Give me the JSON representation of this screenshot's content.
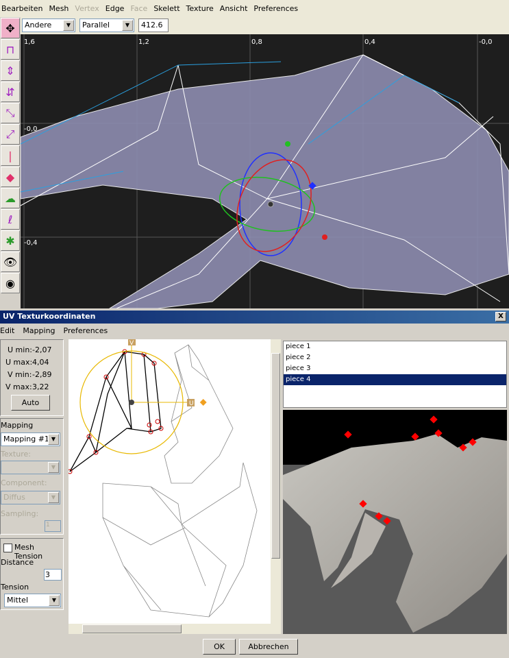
{
  "menubar": {
    "items": [
      {
        "label": "Bearbeiten",
        "enabled": true
      },
      {
        "label": "Mesh",
        "enabled": true
      },
      {
        "label": "Vertex",
        "enabled": false
      },
      {
        "label": "Edge",
        "enabled": true
      },
      {
        "label": "Face",
        "enabled": false
      },
      {
        "label": "Skelett",
        "enabled": true
      },
      {
        "label": "Texture",
        "enabled": true
      },
      {
        "label": "Ansicht",
        "enabled": true
      },
      {
        "label": "Preferences",
        "enabled": true
      }
    ]
  },
  "toolbar": {
    "view_select": "Andere",
    "projection_select": "Parallel",
    "zoom_value": "412.6"
  },
  "viewport": {
    "x_ticks": [
      "1,6",
      "1,2",
      "0,8",
      "0,4",
      "-0,0"
    ],
    "y_ticks": [
      "-0,0",
      "-0,4"
    ]
  },
  "dialog": {
    "title": "UV Texturkoordinaten",
    "close": "X",
    "menu": [
      "Edit",
      "Mapping",
      "Preferences"
    ],
    "ranges": {
      "umin_label": "U min:",
      "umin": "-2,07",
      "umax_label": "U max:",
      "umax": "4,04",
      "vmin_label": "V min:",
      "vmin": "-2,89",
      "vmax_label": "V max:",
      "vmax": "3,22",
      "auto": "Auto"
    },
    "mapping": {
      "title": "Mapping",
      "value": "Mapping #1",
      "texture_label": "Texture:",
      "texture_value": "",
      "component_label": "Component:",
      "component_value": "Diffus",
      "sampling_label": "Sampling:",
      "sampling_value": "1"
    },
    "tension": {
      "checkbox": "Mesh Tension",
      "checked": false,
      "distance_label": "Distance",
      "distance_value": "3",
      "tension_label": "Tension",
      "tension_value": "Mittel"
    },
    "pieces": [
      {
        "label": "piece 1",
        "selected": false
      },
      {
        "label": "piece 2",
        "selected": false
      },
      {
        "label": "piece 3",
        "selected": false
      },
      {
        "label": "piece 4",
        "selected": true
      }
    ],
    "gizmo_labels": {
      "v": "V",
      "u": "U"
    },
    "ok": "OK",
    "cancel": "Abbrechen"
  }
}
